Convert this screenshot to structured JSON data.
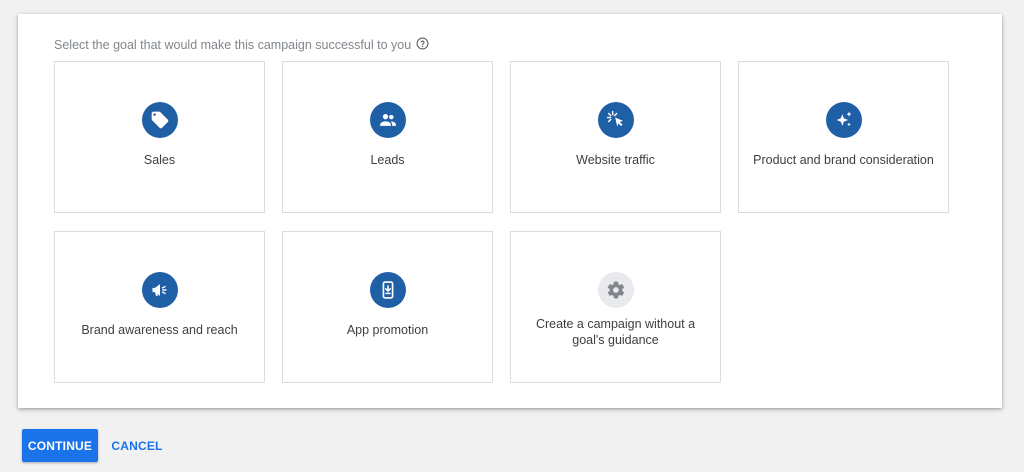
{
  "prompt": {
    "text": "Select the goal that would make this campaign successful to you"
  },
  "goals": [
    {
      "label": "Sales",
      "icon": "tag-icon"
    },
    {
      "label": "Leads",
      "icon": "people-icon"
    },
    {
      "label": "Website traffic",
      "icon": "cursor-click-icon"
    },
    {
      "label": "Product and brand consideration",
      "icon": "sparkle-icon"
    },
    {
      "label": "Brand awareness and reach",
      "icon": "megaphone-icon"
    },
    {
      "label": "App promotion",
      "icon": "phone-download-icon"
    },
    {
      "label_line1": "Create a campaign without a",
      "label_line2": "goal's guidance",
      "icon": "gear-icon"
    }
  ],
  "actions": {
    "continue_label": "CONTINUE",
    "cancel_label": "CANCEL"
  },
  "colors": {
    "icon_badge": "#1f5fa6",
    "icon_badge_muted": "#e8eaed",
    "primary": "#1a73e8"
  }
}
